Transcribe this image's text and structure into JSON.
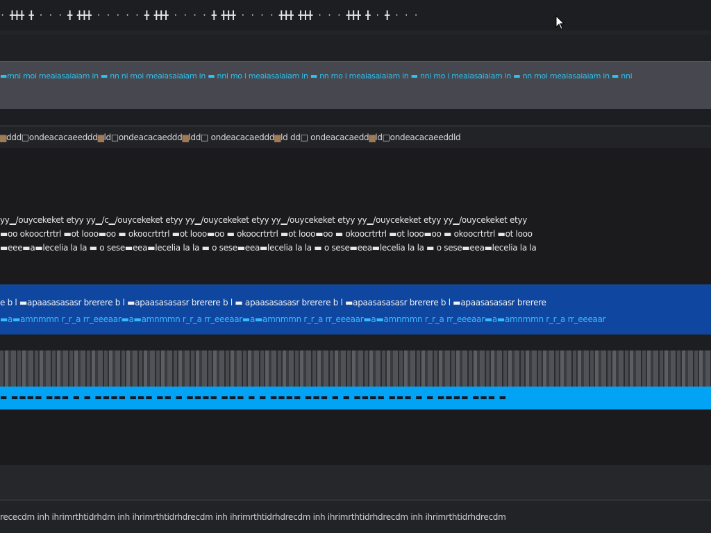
{
  "toolbar": {
    "controls": "·   ╋╋╋  ╋ ·  ·  ·       ╋  ╋╋╋  ·  ·  ·  ·  ·      ╋  ╋╋╋  ·  ·  ·  ·    ╋  ╋╋╋  ·  ·  ·  ·       ╋╋╋  ╋╋╋  ·  ·  ·     ╋╋╋  ╋  ·  ╋  ·  ·  ·"
  },
  "panel": {
    "text": "▬mni  moi meaiasaiaiam in ▬ nn   ni   moi meaiasaiaiam in ▬ nni   mo i meaiasaiaiam in ▬ nn   mo i meaiasaiaiam in ▬ nni   mo i meaiasaiaiam in ▬ nn   moi meaiasaiaiam in ▬ nni"
  },
  "tabs": {
    "text_a": "ddd□ondeacacaeeddd",
    "text_b": "ld□ondeacacaeddd",
    "text_c": "ldd□ ondeacacaeddd",
    "text_d": "ld  dd□ ondeacacaedd",
    "text_e": "ld□ondeacacaeeddld"
  },
  "content": {
    "line1": "yy▁/ouycekeket  etyy  yy▁/c▁/ouycekeket  etyy  yy▁/ouycekeket  etyy  yy▁/ouycekeket  etyy  yy▁/ouycekeket  etyy  yy▁/ouycekeket  etyy",
    "line2": "▬oo okoocrtrtrl  ▬ot looo▬oo ▬ okoocrtrtrl  ▬ot looo▬oo ▬ okoocrtrtrl  ▬ot looo▬oo ▬ okoocrtrtrl  ▬ot looo▬oo ▬ okoocrtrtrl  ▬ot looo",
    "line3": "▬eee▬a▬lecelia la la ▬ o sese▬eea▬lecelia la la ▬ o sese▬eea▬lecelia la la ▬ o sese▬eea▬lecelia la la ▬ o sese▬eea▬lecelia la la"
  },
  "selection": {
    "line1": "e b  l ▬apaasasasasr brerere b  l ▬apaasasasasr brerere b  l ▬ apaasasasasr brerere b  l ▬apaasasasasr brerere b  l ▬apaasasasasr brerere",
    "line2": "▬a▬amnmmn r_r_a rr_eeeaar▬a▬amnmmn r_r_a rr_eeeaar▬a▬amnmmn r_r_a rr_eeeaar▬a▬amnmmn r_r_a rr_eeeaar▬a▬amnmmn r_r_a rr_eeeaar"
  },
  "cyan_bar": {
    "text": "▬         ▬▬▬▬ ▬▬▬  ▬  ▬    ▬▬▬▬ ▬▬▬ ▬▬  ▬     ▬▬▬▬ ▬▬▬  ▬  ▬    ▬▬▬▬ ▬▬▬  ▬  ▬    ▬▬▬▬ ▬▬▬  ▬  ▬    ▬▬▬▬ ▬▬▬  ▬"
  },
  "status": {
    "text": "rececdm  inh  ihrimrthtidrhdrn  inh  ihrimrthtidrhdrecdm  inh  ihrimrthtidrhdrecdm  inh  ihrimrthtidrhdrecdm  inh  ihrimrthtidrhdrecdm"
  },
  "colors": {
    "background": "#1c1c1f",
    "panel_gray": "#46474f",
    "selection_blue": "#0f47a0",
    "cyan_accent": "#02a2f4",
    "text_cyan": "#2dc3f0"
  }
}
